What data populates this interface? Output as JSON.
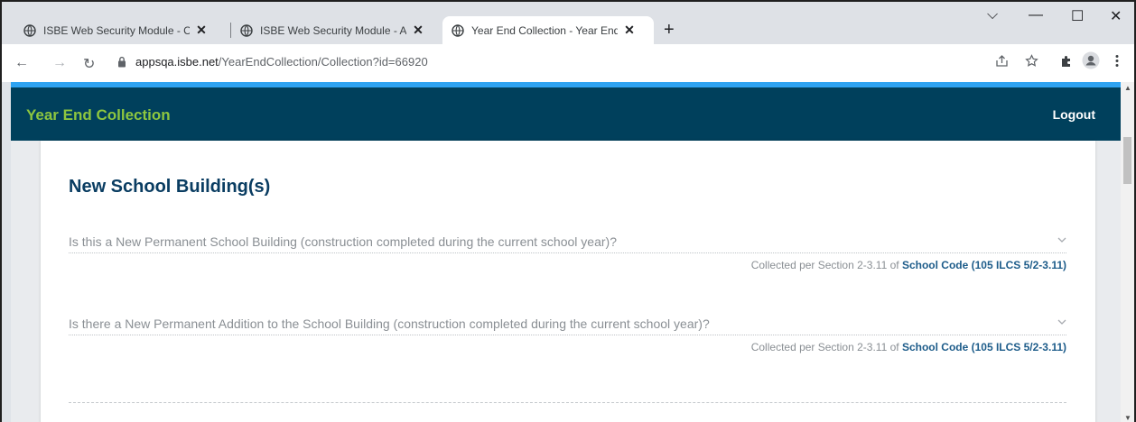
{
  "browser": {
    "tabs": [
      {
        "title": "ISBE Web Security Module - Cool",
        "close": "✕"
      },
      {
        "title": "ISBE Web Security Module - Appl",
        "close": "✕"
      },
      {
        "title": "Year End Collection - Year End Co",
        "close": "✕"
      }
    ],
    "new_tab": "+",
    "window_controls": {
      "dropdown": "⌵",
      "minimize": "—",
      "maximize": "☐",
      "close": "✕"
    },
    "nav": {
      "back": "←",
      "forward": "→",
      "reload": "↻"
    },
    "url": {
      "domain": "appsqa.isbe.net",
      "path": "/YearEndCollection/Collection?id=66920"
    },
    "toolbar_icons": [
      "share-icon",
      "star-icon",
      "extensions-icon",
      "profile-icon",
      "menu-icon"
    ]
  },
  "app": {
    "title": "Year End Collection",
    "logout": "Logout",
    "accent": "#8dc63f",
    "header_bg": "#00405c"
  },
  "section": {
    "title": "New School Building(s)",
    "questions": [
      {
        "text": "Is this a New Permanent School Building (construction completed during the current school year)?",
        "note_prefix": "Collected per Section 2-3.11 of ",
        "note_link": "School Code (105 ILCS 5/2-3.11)"
      },
      {
        "text": "Is there a New Permanent Addition to the School Building (construction completed during the current school year)?",
        "note_prefix": "Collected per Section 2-3.11 of ",
        "note_link": "School Code (105 ILCS 5/2-3.11)"
      }
    ]
  }
}
